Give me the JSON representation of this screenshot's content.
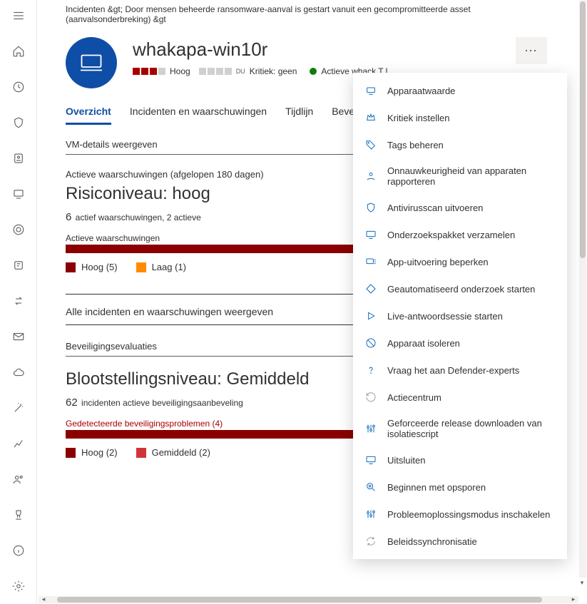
{
  "breadcrumb": "Incidenten &gt;    Door mensen beheerde ransomware-aanval is gestart vanuit een gecompromitteerde asset (aanvalsonderbreking) &gt",
  "header": {
    "title": "whakapa-win10r",
    "sev_label": "Hoog",
    "crit_label": "Kritiek: geen",
    "active_label": "Actieve whack T l",
    "super": "DU"
  },
  "tabs": [
    "Overzicht",
    "Incidenten en waarschuwingen",
    "Tijdlijn",
    "Beveiliging"
  ],
  "vm_link": "VM-details weergeven",
  "alerts": {
    "heading": "Actieve waarschuwingen (afgelopen 180 dagen)",
    "risk_title": "Risiconiveau: hoog",
    "count_strong": "6",
    "count_text": " actief waarschuwingen, 2 actieve",
    "bar_label": "Actieve waarschuwingen",
    "legend": [
      {
        "label": "Hoog (5)",
        "swatch": "sw-dark"
      },
      {
        "label": "Laag (1)",
        "swatch": "sw-orange"
      }
    ]
  },
  "all_incidents": "Alle incidenten en waarschuwingen weergeven",
  "exposure": {
    "heading": "Beveiligingsevaluaties",
    "title": "Blootstellingsniveau: Gemiddeld",
    "count_strong": "62",
    "count_text": " incidenten actieve beveiligingsaanbeveling",
    "bar_label": "Gedetecteerde beveiligingsproblemen (4)",
    "legend": [
      {
        "label": "Hoog (2)",
        "swatch": "sw-dark"
      },
      {
        "label": "Gemiddeld (2)",
        "swatch": "sw-red"
      }
    ]
  },
  "menu": [
    {
      "label": "Apparaatwaarde",
      "icon": "value"
    },
    {
      "label": "Kritiek instellen",
      "icon": "crown"
    },
    {
      "label": "Tags beheren",
      "icon": "tag"
    },
    {
      "label": "Onnauwkeurigheid van apparaten rapporteren",
      "icon": "person"
    },
    {
      "label": "Antivirusscan uitvoeren",
      "icon": "shield"
    },
    {
      "label": "Onderzoekspakket verzamelen",
      "icon": "monitor"
    },
    {
      "label": "App-uitvoering beperken",
      "icon": "restrict"
    },
    {
      "label": "Geautomatiseerd onderzoek starten",
      "icon": "diamond"
    },
    {
      "label": "Live-antwoordsessie starten",
      "icon": "play"
    },
    {
      "label": "Apparaat isoleren",
      "icon": "isolate"
    },
    {
      "label": "Vraag het aan Defender-experts",
      "icon": "question"
    },
    {
      "label": "Actiecentrum",
      "icon": "history",
      "muted": true
    },
    {
      "label": "Geforceerde release downloaden van isolatiescript",
      "icon": "sliders"
    },
    {
      "label": "Uitsluiten",
      "icon": "monitor"
    },
    {
      "label": "Beginnen met opsporen",
      "icon": "hunt"
    },
    {
      "label": "Probleemoplossingsmodus inschakelen",
      "icon": "sliders"
    },
    {
      "label": "Beleidssynchronisatie",
      "icon": "sync",
      "muted": true
    }
  ],
  "chart_data": [
    {
      "type": "bar",
      "title": "Actieve waarschuwingen",
      "categories": [
        "Hoog",
        "Laag"
      ],
      "values": [
        5,
        1
      ],
      "colors": [
        "#8a0000",
        "#ff8c00"
      ]
    },
    {
      "type": "bar",
      "title": "Gedetecteerde beveiligingsproblemen (4)",
      "categories": [
        "Hoog",
        "Gemiddeld"
      ],
      "values": [
        2,
        2
      ],
      "colors": [
        "#8a0000",
        "#d13438"
      ]
    }
  ],
  "rail_icons": [
    "menu",
    "home",
    "clock",
    "shield",
    "scan",
    "screen",
    "lock",
    "badge",
    "swap",
    "mail",
    "cloud",
    "wand",
    "chart",
    "people",
    "trophy",
    "info",
    "settings"
  ]
}
